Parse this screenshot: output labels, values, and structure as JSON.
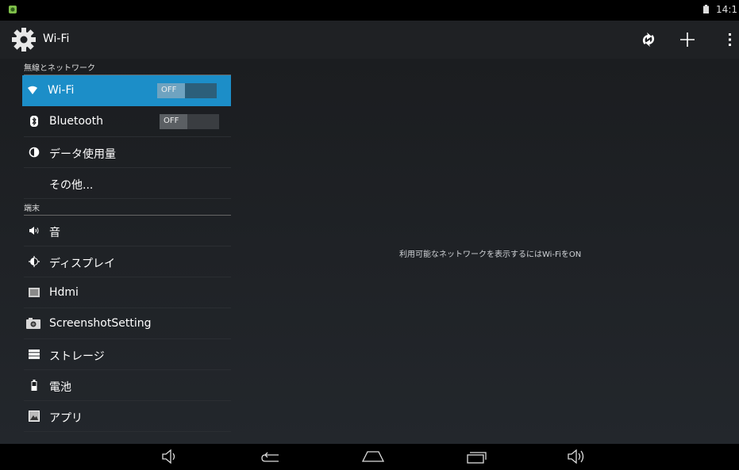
{
  "status_bar": {
    "time": "14:1"
  },
  "action_bar": {
    "title": "Wi-Fi"
  },
  "sidebar": {
    "sections": [
      {
        "header": "無線とネットワーク"
      },
      {
        "header": "端末"
      }
    ],
    "wireless_items": [
      {
        "label": "Wi-Fi",
        "toggle": "OFF",
        "icon": "wifi-icon"
      },
      {
        "label": "Bluetooth",
        "toggle": "OFF",
        "icon": "bluetooth-icon"
      },
      {
        "label": "データ使用量",
        "icon": "data-usage-icon"
      },
      {
        "label": "その他..."
      }
    ],
    "device_items": [
      {
        "label": "音",
        "icon": "sound-icon"
      },
      {
        "label": "ディスプレイ",
        "icon": "display-icon"
      },
      {
        "label": "Hdmi",
        "icon": "hdmi-icon"
      },
      {
        "label": "ScreenshotSetting",
        "icon": "camera-icon"
      },
      {
        "label": "ストレージ",
        "icon": "storage-icon"
      },
      {
        "label": "電池",
        "icon": "battery-icon"
      },
      {
        "label": "アプリ",
        "icon": "apps-icon"
      }
    ]
  },
  "main": {
    "message": "利用可能なネットワークを表示するにはWi-FiをON"
  },
  "colors": {
    "accent": "#1c8ec8",
    "background": "#1b1d20"
  }
}
